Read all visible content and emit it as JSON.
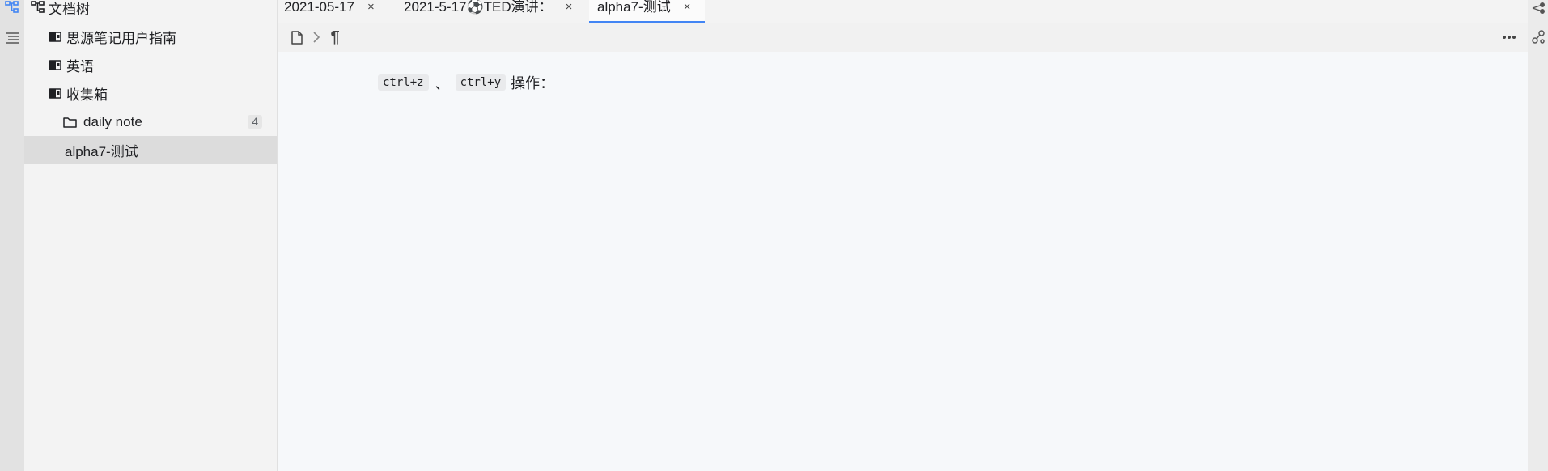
{
  "sidebar": {
    "title": "文档树",
    "items": [
      {
        "label": "思源笔记用户指南",
        "kind": "notebook"
      },
      {
        "label": "英语",
        "kind": "notebook"
      },
      {
        "label": "收集箱",
        "kind": "notebook"
      },
      {
        "label": "daily note",
        "kind": "folder",
        "count": "4"
      },
      {
        "label": "alpha7-测试",
        "kind": "document",
        "active": true
      }
    ]
  },
  "tabs": [
    {
      "label": "2021-05-17",
      "close": "×"
    },
    {
      "label": "2021-5-17⚽TED演讲：",
      "close": "×"
    },
    {
      "label": "alpha7-测试",
      "close": "×",
      "active": true
    }
  ],
  "toolbar": {
    "icons": [
      "file-icon",
      "chevron-right-icon",
      "paragraph-icon",
      "more-icon"
    ],
    "paragraph_symbol": "¶"
  },
  "editor": {
    "kbd1": "ctrl+z",
    "separator": "、",
    "kbd2": "ctrl+y",
    "tail": "操作："
  },
  "colors": {
    "accent": "#4285f4",
    "active_row": "#dcdcdc",
    "sidebar_bg": "#f3f3f3",
    "editor_bg": "#f6f8fa"
  }
}
